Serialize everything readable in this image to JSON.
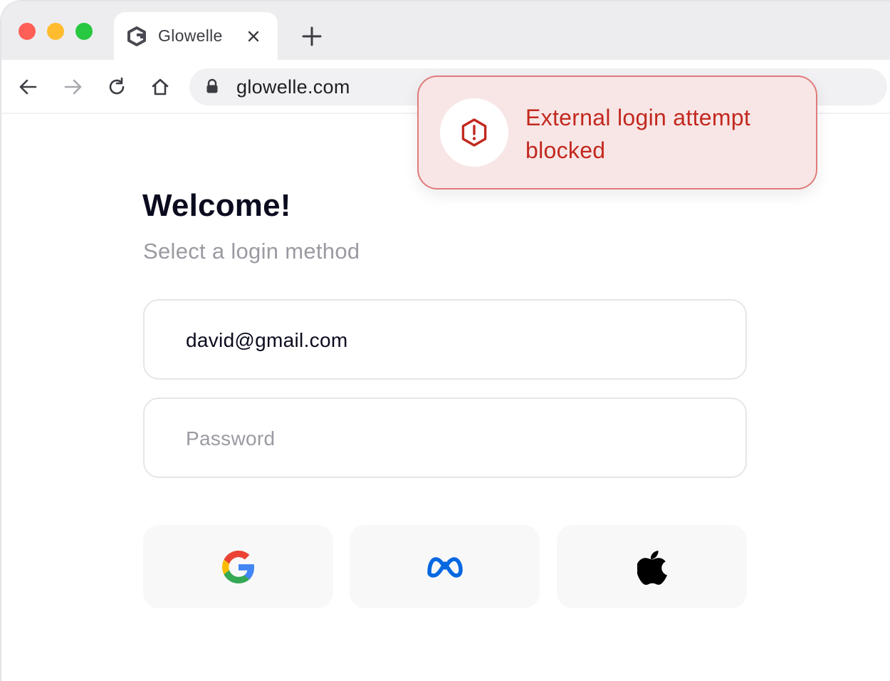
{
  "browser": {
    "tab": {
      "title": "Glowelle",
      "favicon": "glowelle-logo-icon"
    },
    "address": {
      "url": "glowelle.com"
    },
    "icons": [
      "back-arrow-icon",
      "forward-arrow-icon",
      "reload-icon",
      "home-icon",
      "lock-icon",
      "close-icon",
      "plus-icon"
    ]
  },
  "login": {
    "title": "Welcome!",
    "subtitle": "Select a login method",
    "email_value": "david@gmail.com",
    "password_placeholder": "Password",
    "providers": [
      "google-logo-icon",
      "meta-logo-icon",
      "apple-logo-icon"
    ]
  },
  "toast": {
    "message": "External login attempt\n blocked",
    "icon": "alert-hexagon-icon"
  },
  "colors": {
    "toast_bg": "#f8e6e6",
    "toast_border": "#e07b7b",
    "toast_text": "#c2291f",
    "meta_blue": "#0668e1"
  }
}
